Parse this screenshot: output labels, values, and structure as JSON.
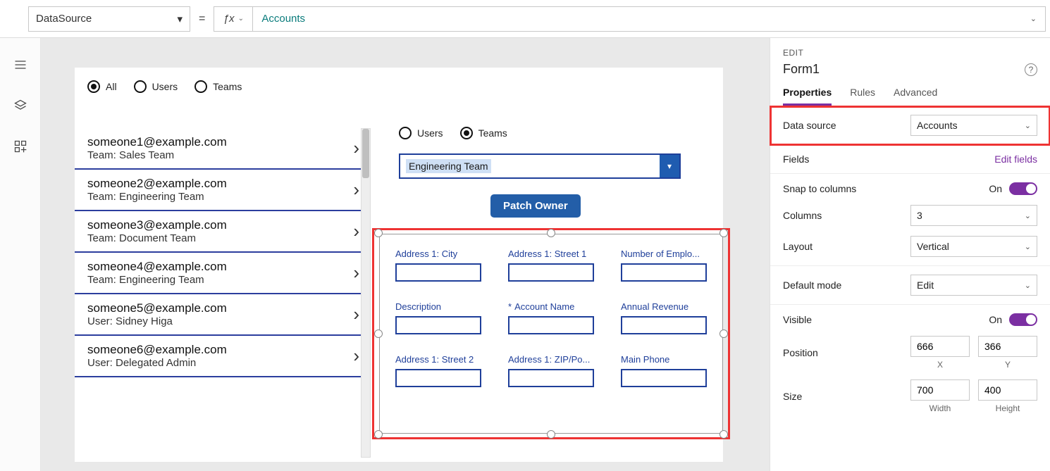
{
  "formula": {
    "property": "DataSource",
    "expression": "Accounts"
  },
  "leftFilter": {
    "options": [
      "All",
      "Users",
      "Teams"
    ],
    "selected": 0
  },
  "list": [
    {
      "title": "someone1@example.com",
      "sub": "Team: Sales Team"
    },
    {
      "title": "someone2@example.com",
      "sub": "Team: Engineering Team"
    },
    {
      "title": "someone3@example.com",
      "sub": "Team: Document Team"
    },
    {
      "title": "someone4@example.com",
      "sub": "Team: Engineering Team"
    },
    {
      "title": "someone5@example.com",
      "sub": "User: Sidney Higa"
    },
    {
      "title": "someone6@example.com",
      "sub": "User: Delegated Admin"
    }
  ],
  "detail": {
    "filter": {
      "options": [
        "Users",
        "Teams"
      ],
      "selected": 1
    },
    "combo_value": "Engineering Team",
    "button_label": "Patch Owner"
  },
  "form_fields": [
    {
      "label": "Address 1: City",
      "required": false
    },
    {
      "label": "Address 1: Street 1",
      "required": false
    },
    {
      "label": "Number of Emplo...",
      "required": false
    },
    {
      "label": "Description",
      "required": false
    },
    {
      "label": "Account Name",
      "required": true
    },
    {
      "label": "Annual Revenue",
      "required": false
    },
    {
      "label": "Address 1: Street 2",
      "required": false
    },
    {
      "label": "Address 1: ZIP/Po...",
      "required": false
    },
    {
      "label": "Main Phone",
      "required": false
    }
  ],
  "panel": {
    "caption": "EDIT",
    "name": "Form1",
    "tabs": [
      "Properties",
      "Rules",
      "Advanced"
    ],
    "active_tab": 0,
    "data_source_label": "Data source",
    "data_source_value": "Accounts",
    "fields_label": "Fields",
    "edit_fields_link": "Edit fields",
    "snap_label": "Snap to columns",
    "snap_on": "On",
    "columns_label": "Columns",
    "columns_value": "3",
    "layout_label": "Layout",
    "layout_value": "Vertical",
    "default_mode_label": "Default mode",
    "default_mode_value": "Edit",
    "visible_label": "Visible",
    "visible_on": "On",
    "position_label": "Position",
    "position_x": "666",
    "position_y": "366",
    "pos_x_cap": "X",
    "pos_y_cap": "Y",
    "size_label": "Size",
    "size_w": "700",
    "size_h": "400",
    "size_w_cap": "Width",
    "size_h_cap": "Height"
  }
}
